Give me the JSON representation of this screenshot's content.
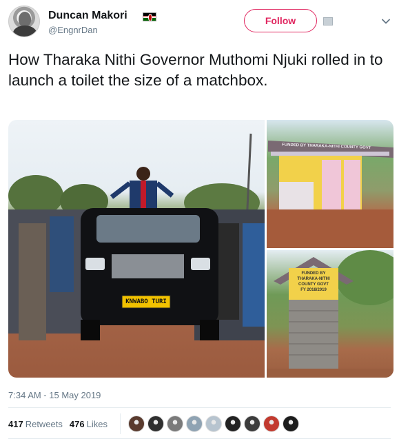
{
  "header": {
    "display_name": "Duncan Makori",
    "handle": "@EngnrDan",
    "follow_label": "Follow"
  },
  "tweet": {
    "text": "How Tharaka Nithi Governor Muthomi Njuki rolled in to launch a toilet the size of a matchbox.",
    "timestamp": "7:34 AM - 15 May 2019"
  },
  "media": {
    "main_photo": {
      "plate": "KNWABO TURI"
    },
    "top_right_photo": {
      "sign": "FUNDED BY THARAKA-NITHI COUNTY GOVT"
    },
    "bottom_right_photo": {
      "sign_lines": [
        "FUNDED BY",
        "THARAKA-NITHI",
        "COUNTY GOVT",
        "FY 2018/2019"
      ]
    }
  },
  "stats": {
    "retweets_count": "417",
    "retweets_label": "Retweets",
    "likes_count": "476",
    "likes_label": "Likes"
  },
  "colors": {
    "follow": "#e0245e",
    "secondary_text": "#657786",
    "divider": "#e6ecf0",
    "liker_avatars": [
      "#5a3b2e",
      "#2f2f2f",
      "#7a7a7a",
      "#8fa3b3",
      "#b7c4cf",
      "#222222",
      "#3c3c3c",
      "#c23a2f",
      "#1c1c1c"
    ]
  }
}
